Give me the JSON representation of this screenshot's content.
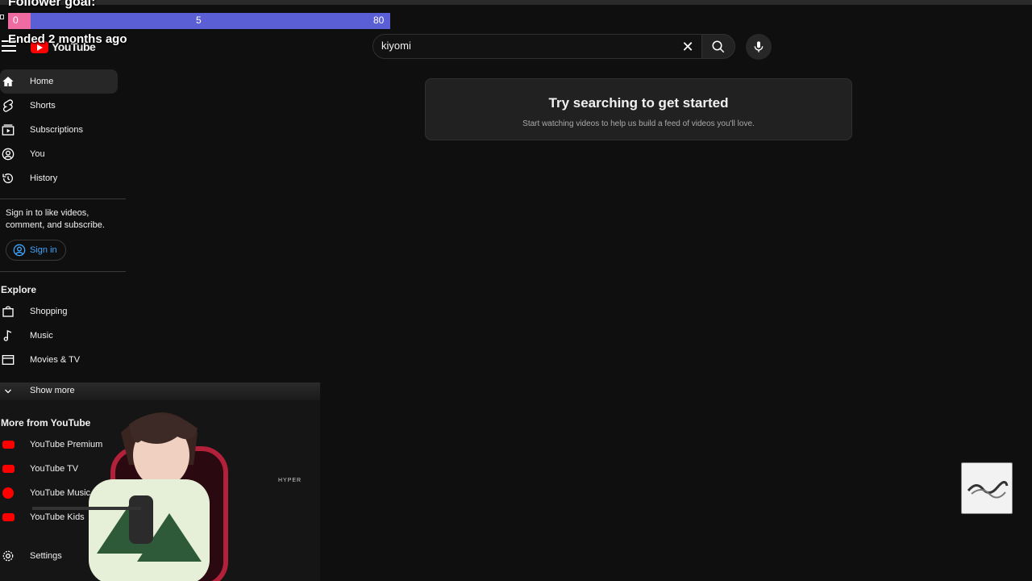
{
  "overlay": {
    "goal_title": "Follower goal:",
    "goal_start": "0",
    "goal_current": "5",
    "goal_target": "80",
    "goal_progress_fraction": 0.0625,
    "goal_status": "Ended 2 months ago",
    "watermark_text": "HYPER",
    "colors": {
      "bar": "#5b5fd6",
      "fill": "#f06ba1"
    }
  },
  "header": {
    "menu_icon": "hamburger-icon",
    "logo_text": "YouTube",
    "search_value": "kiyomi",
    "clear_icon": "close-icon",
    "search_icon": "search-icon",
    "mic_icon": "mic-icon"
  },
  "sidebar": {
    "primary": [
      {
        "label": "Home",
        "icon": "home-icon",
        "active": true
      },
      {
        "label": "Shorts",
        "icon": "shorts-icon"
      },
      {
        "label": "Subscriptions",
        "icon": "subscriptions-icon"
      },
      {
        "label": "You",
        "icon": "user-circle-icon"
      },
      {
        "label": "History",
        "icon": "history-icon"
      }
    ],
    "signin_prompt": "Sign in to like videos, comment, and subscribe.",
    "signin_label": "Sign in",
    "explore_title": "Explore",
    "explore": [
      {
        "label": "Shopping",
        "icon": "shopping-bag-icon"
      },
      {
        "label": "Music",
        "icon": "music-note-icon"
      },
      {
        "label": "Movies & TV",
        "icon": "clapperboard-icon"
      }
    ],
    "show_more": "Show more",
    "more_title": "More from YouTube",
    "more": [
      {
        "label": "YouTube Premium"
      },
      {
        "label": "YouTube TV"
      },
      {
        "label": "YouTube Music"
      },
      {
        "label": "YouTube Kids"
      }
    ],
    "settings_label": "Settings"
  },
  "main": {
    "empty_title": "Try searching to get started",
    "empty_subtitle": "Start watching videos to help us build a feed of videos you'll love."
  },
  "theme": {
    "background": "#0f0f0f",
    "accent": "#ff0000",
    "link": "#3ea6ff"
  }
}
